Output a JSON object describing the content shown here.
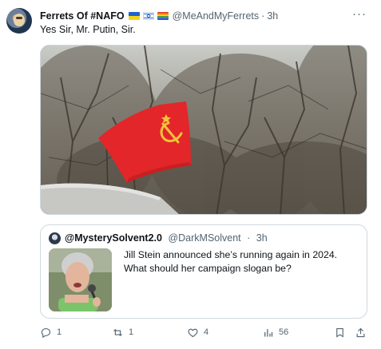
{
  "tweet": {
    "display_name": "Ferrets Of #NAFO",
    "handle": "@MeAndMyFerrets",
    "separator": "·",
    "time": "3h",
    "text": "Yes Sir, Mr. Putin, Sir.",
    "more_label": "···"
  },
  "quote": {
    "display_name": "@MysterySolvent2.0",
    "handle": "@DarkMSolvent",
    "separator": "·",
    "time": "3h",
    "text": "Jill Stein announced she’s running again in 2024. What should her campaign slogan be?"
  },
  "actions": {
    "replies": "1",
    "reposts": "1",
    "likes": "4",
    "views": "56"
  },
  "icons": {
    "reply": "reply-icon",
    "repost": "repost-icon",
    "like": "heart-icon",
    "views": "views-icon",
    "bookmark": "bookmark-icon",
    "share": "share-icon"
  },
  "colors": {
    "flag_red": "#e3262a",
    "hammer_sickle": "#f2c23a",
    "muted_text": "#536471"
  }
}
